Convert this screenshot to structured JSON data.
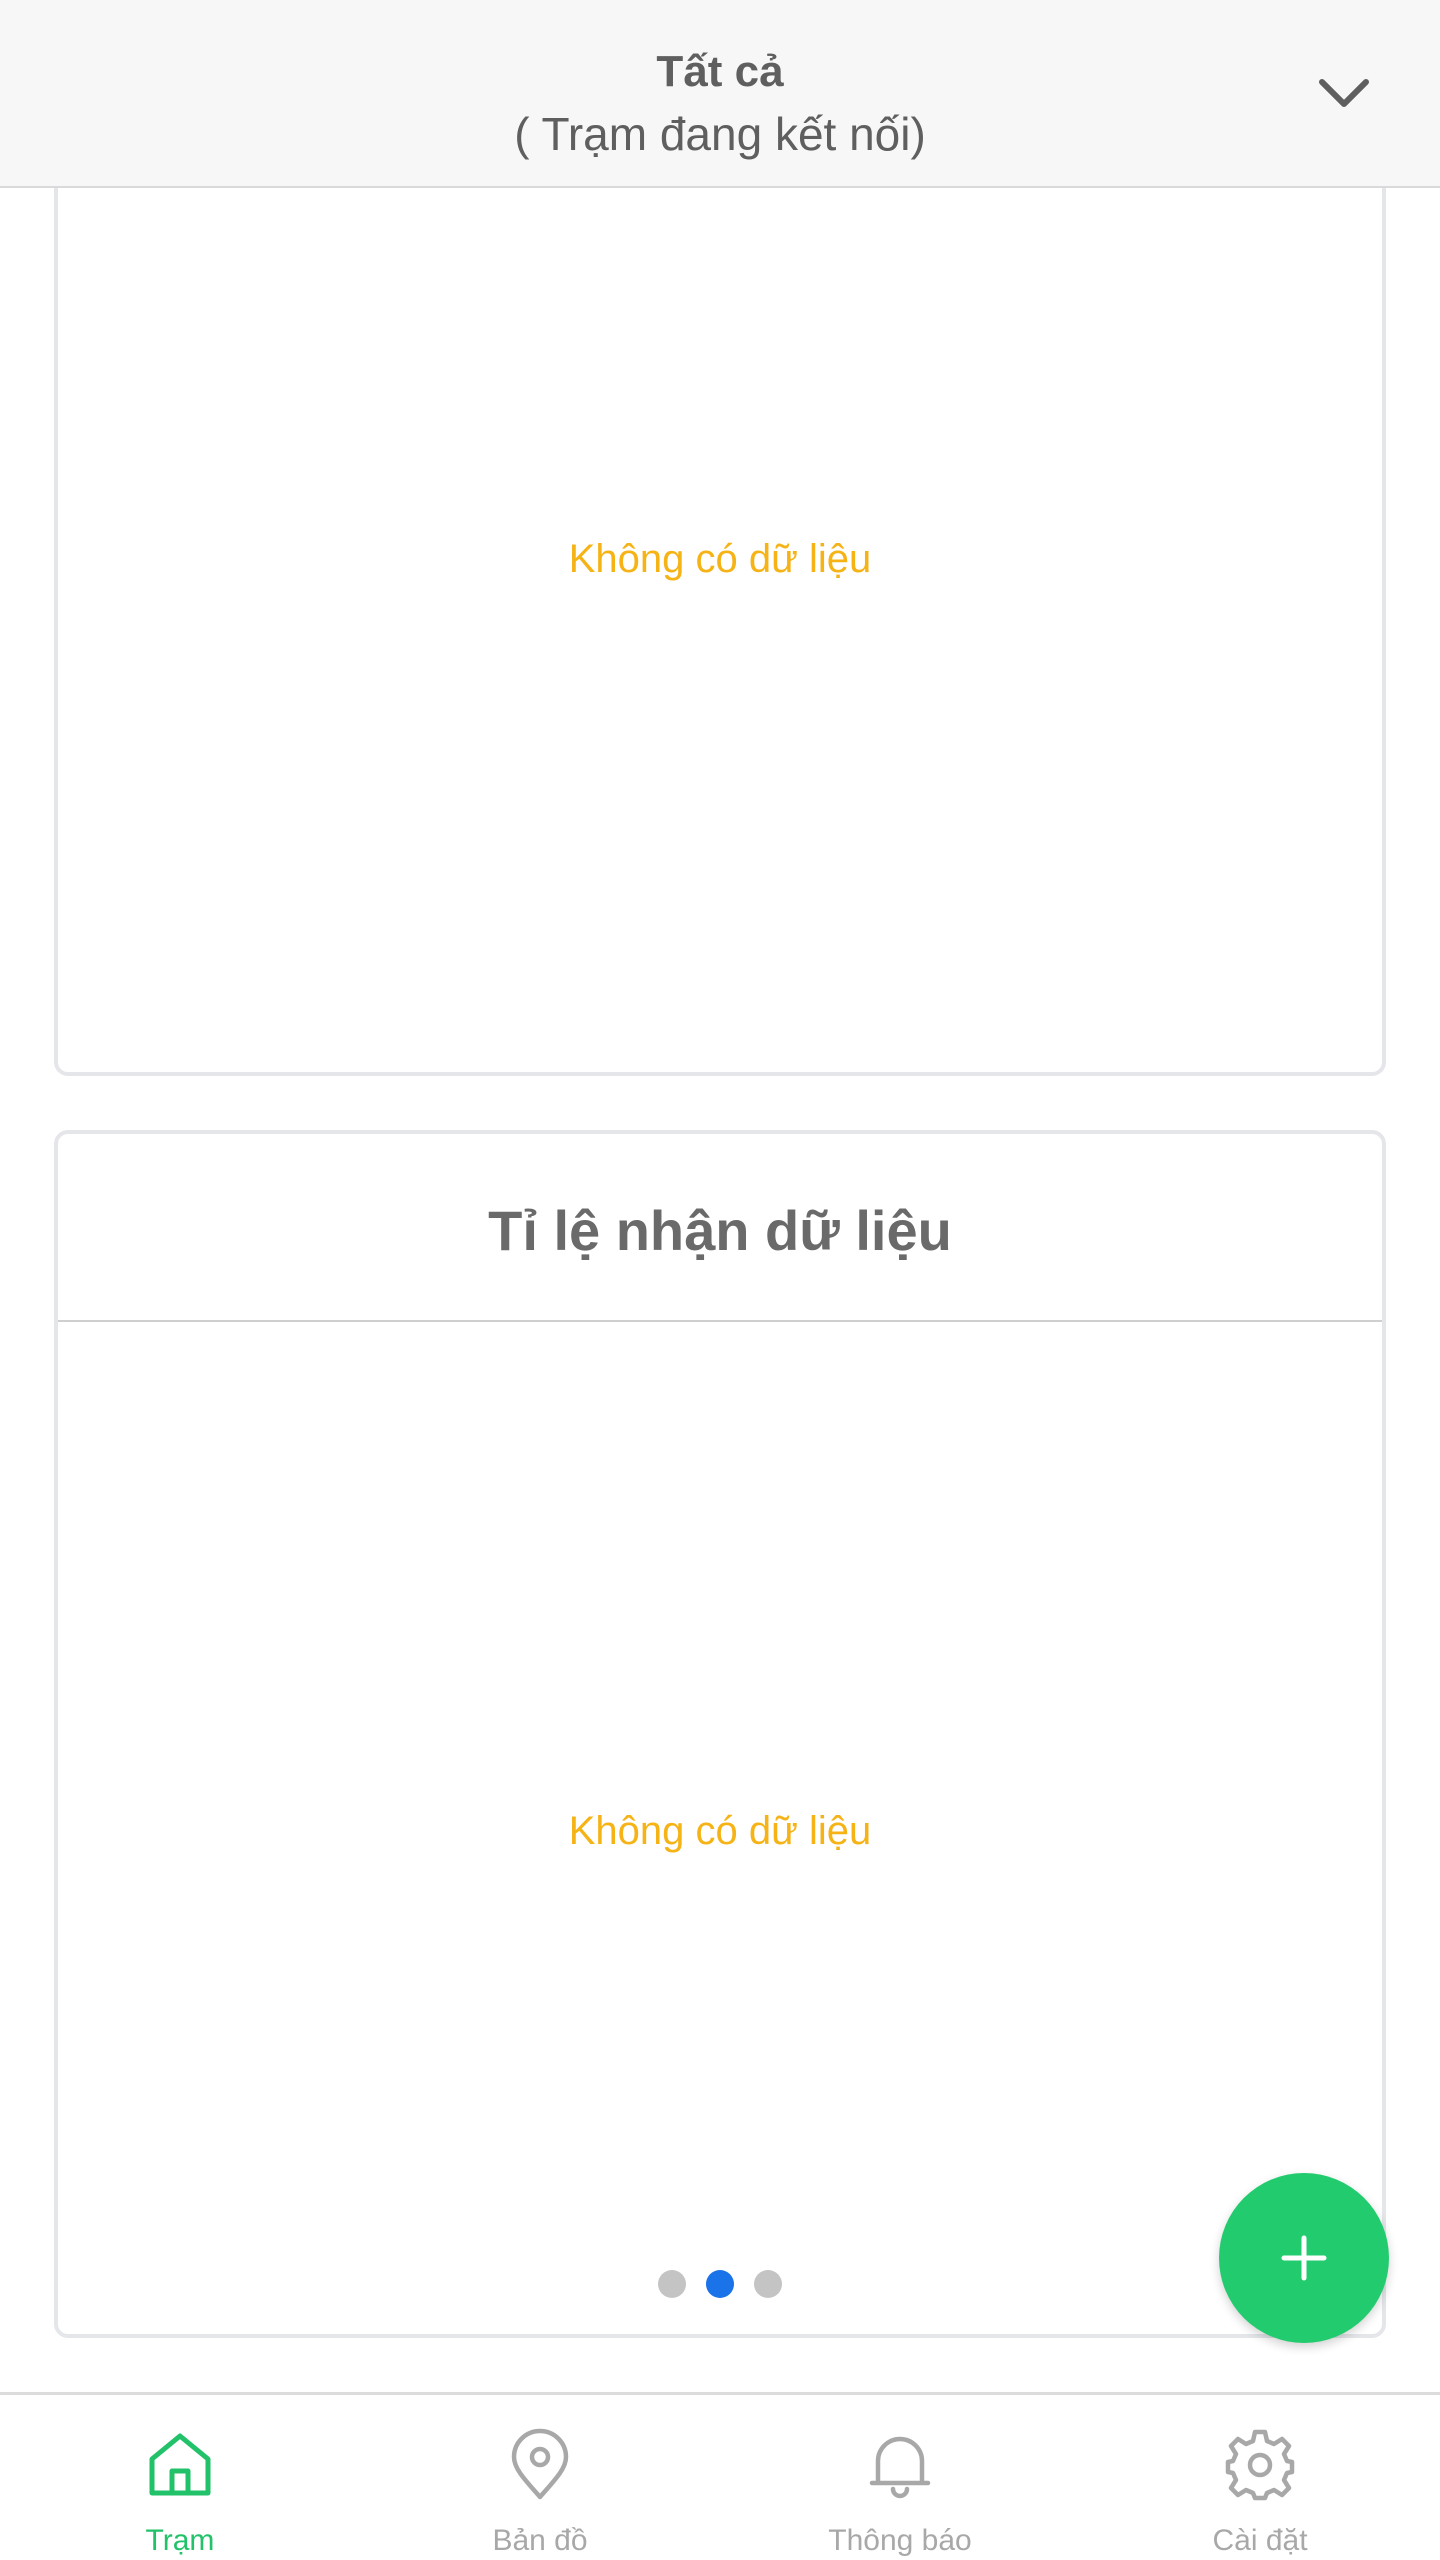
{
  "header": {
    "title": "Tất cả",
    "subtitle": "( Trạm đang kết nối)",
    "dropdown_icon": "chevron-down-icon"
  },
  "cards": [
    {
      "empty_text": "Không có dữ liệu"
    },
    {
      "title": "Tỉ lệ nhận dữ liệu",
      "empty_text": "Không có dữ liệu",
      "pager": {
        "count": 3,
        "active_index": 1
      }
    }
  ],
  "fab": {
    "icon": "plus-icon"
  },
  "bottom_nav": {
    "items": [
      {
        "label": "Trạm",
        "icon": "home-icon",
        "active": true
      },
      {
        "label": "Bản đồ",
        "icon": "map-pin-icon",
        "active": false
      },
      {
        "label": "Thông báo",
        "icon": "bell-icon",
        "active": false
      },
      {
        "label": "Cài đặt",
        "icon": "gear-icon",
        "active": false
      }
    ]
  },
  "colors": {
    "accent_green": "#22cc6e",
    "active_dot": "#1a73e8",
    "empty_text": "#f5b316",
    "inactive_gray": "#a8a8a8"
  }
}
